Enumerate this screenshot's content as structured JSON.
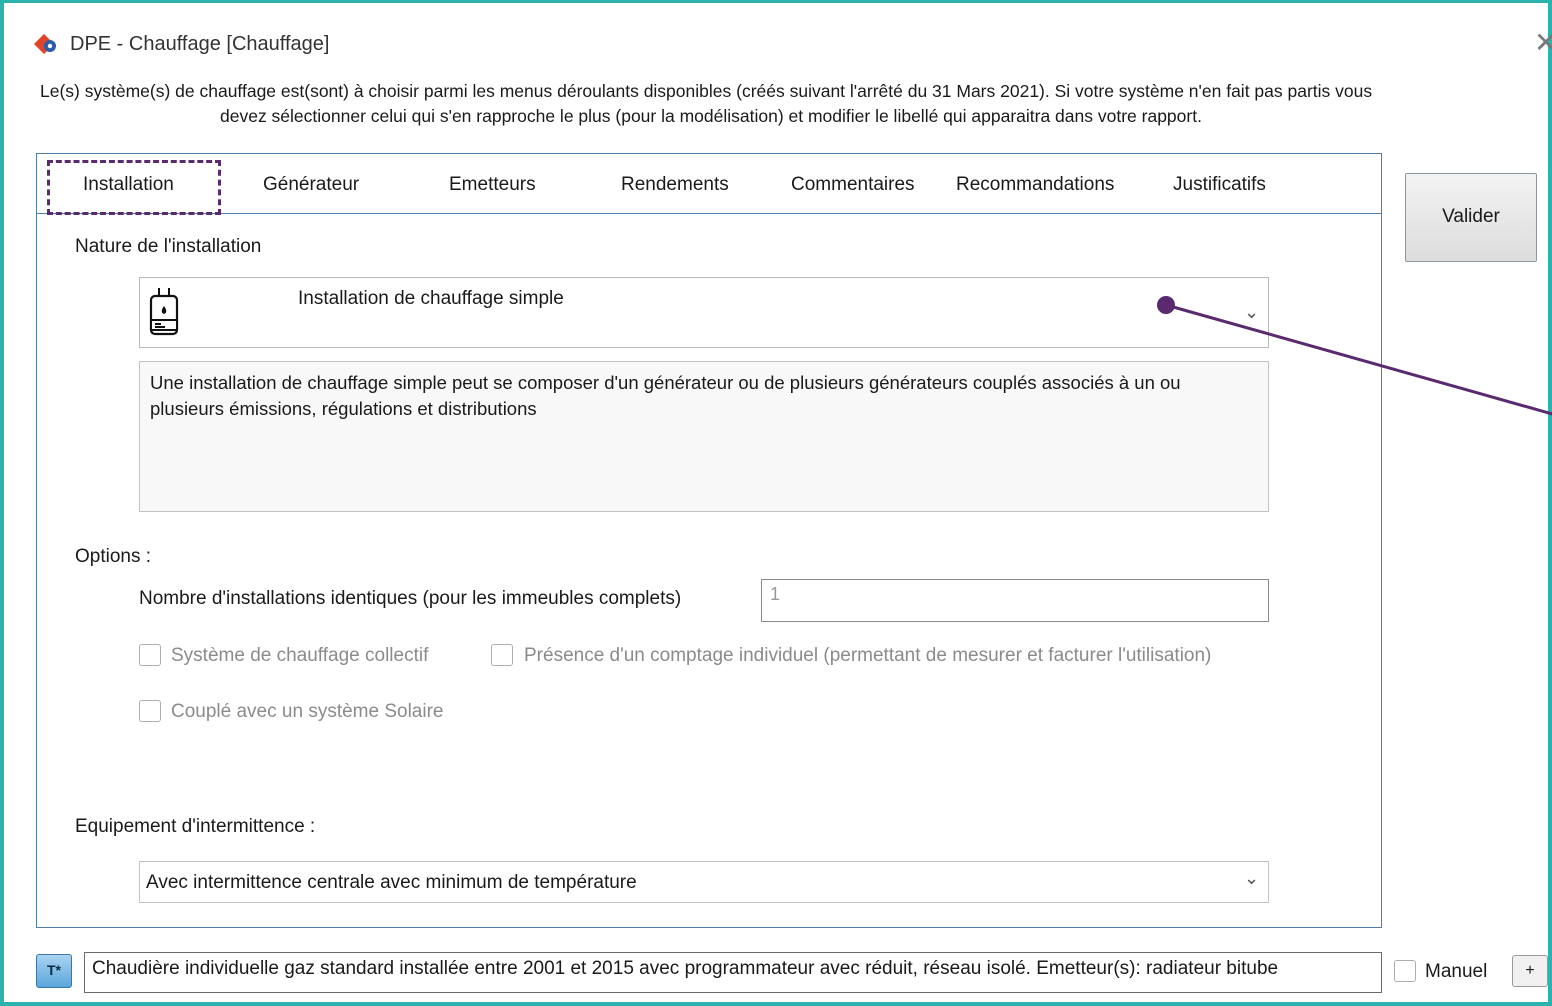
{
  "window": {
    "title": "DPE - Chauffage [Chauffage]",
    "close_glyph": "✕"
  },
  "info": {
    "line1": "Le(s) système(s) de chauffage est(sont) à choisir parmi les menus déroulants disponibles (créés suivant l'arrêté du 31 Mars 2021). Si votre système n'en fait pas partis vous",
    "line2": "devez sélectionner celui qui s'en rapproche le plus (pour la modélisation) et modifier le libellé qui apparaitra dans votre rapport."
  },
  "tabs": [
    {
      "label": "Installation",
      "active": true
    },
    {
      "label": "Générateur"
    },
    {
      "label": "Emetteurs"
    },
    {
      "label": "Rendements"
    },
    {
      "label": "Commentaires"
    },
    {
      "label": "Recommandations"
    },
    {
      "label": "Justificatifs"
    }
  ],
  "installation": {
    "nature_label": "Nature de l'installation",
    "nature_value": "Installation de chauffage simple",
    "nature_icon": "boiler-icon",
    "description": "Une installation de chauffage simple peut se composer d'un générateur ou de plusieurs générateurs couplés associés à un ou plusieurs émissions, régulations et distributions",
    "options_label": "Options :",
    "count_label": "Nombre d'installations identiques (pour les immeubles complets)",
    "count_value": "1",
    "checkboxes": {
      "collectif": "Système de chauffage collectif",
      "comptage": "Présence d'un comptage individuel (permettant de mesurer et facturer l'utilisation)",
      "solaire": "Couplé avec un système Solaire"
    },
    "intermittence_label": "Equipement d'intermittence :",
    "intermittence_value": "Avec intermittence centrale avec minimum de température"
  },
  "buttons": {
    "valider": "Valider",
    "t_star": "T*",
    "plus": "+",
    "manuel": "Manuel"
  },
  "libelle": "Chaudière individuelle gaz standard installée entre 2001 et 2015 avec programmateur avec réduit, réseau isolé. Emetteur(s): radiateur bitube",
  "colors": {
    "window_border": "#2cb3ad",
    "panel_border": "#4d7fa8",
    "annotation": "#5a2a6e"
  }
}
